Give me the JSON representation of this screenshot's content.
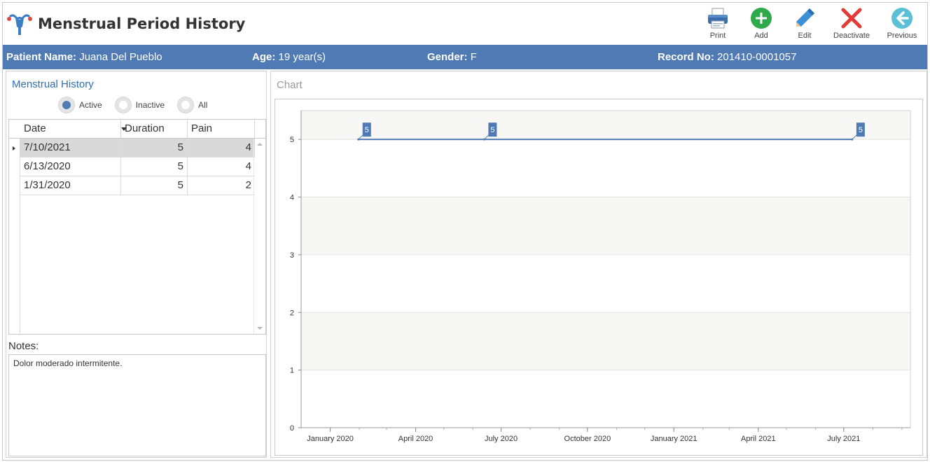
{
  "app": {
    "title": "Menstrual Period History",
    "logo_icon": "uterus-icon"
  },
  "toolbar": {
    "print_label": "Print",
    "add_label": "Add",
    "edit_label": "Edit",
    "deactivate_label": "Deactivate",
    "previous_label": "Previous"
  },
  "patient": {
    "name_label": "Patient Name:",
    "name": "Juana Del Pueblo",
    "age_label": "Age:",
    "age": "19 year(s)",
    "gender_label": "Gender:",
    "gender": "F",
    "record_label": "Record No:",
    "record": "201410-0001057"
  },
  "history": {
    "title": "Menstrual History",
    "filters": [
      "Active",
      "Inactive",
      "All"
    ],
    "selected_filter": "Active",
    "columns": [
      "Date",
      "Duration",
      "Pain"
    ],
    "rows": [
      {
        "date": "7/10/2021",
        "duration": "5",
        "pain": "4"
      },
      {
        "date": "6/13/2020",
        "duration": "5",
        "pain": "4"
      },
      {
        "date": "1/31/2020",
        "duration": "5",
        "pain": "2"
      }
    ],
    "selected_row": 0
  },
  "notes": {
    "label": "Notes:",
    "text": "Dolor moderado intermitente."
  },
  "chart_caption": "Chart",
  "chart_data": {
    "type": "line",
    "title": "",
    "xlabel": "",
    "ylabel": "",
    "x": [
      "2020-01-31",
      "2020-06-13",
      "2021-07-10"
    ],
    "series": [
      {
        "values": [
          5,
          5,
          5
        ],
        "color": "#4f7ab3",
        "data_labels": [
          "5",
          "5",
          "5"
        ]
      }
    ],
    "xlim": [
      "2019-12-01",
      "2021-09-10"
    ],
    "x_ticks": [
      {
        "date": "2020-01-01",
        "label": "January 2020"
      },
      {
        "date": "2020-04-01",
        "label": "April 2020"
      },
      {
        "date": "2020-07-01",
        "label": "July 2020"
      },
      {
        "date": "2020-10-01",
        "label": "October 2020"
      },
      {
        "date": "2021-01-01",
        "label": "January 2021"
      },
      {
        "date": "2021-04-01",
        "label": "April 2021"
      },
      {
        "date": "2021-07-01",
        "label": "July 2021"
      }
    ],
    "ylim": [
      0,
      5.5
    ],
    "y_ticks": [
      0,
      1,
      2,
      3,
      4,
      5
    ],
    "grid": true,
    "legend": "none"
  },
  "colors": {
    "accent": "#4f7ab3",
    "title_blue": "#2e6fb2",
    "add_green": "#2eaa4a",
    "deactivate_red": "#e53935",
    "previous_teal": "#5bc0d6"
  }
}
